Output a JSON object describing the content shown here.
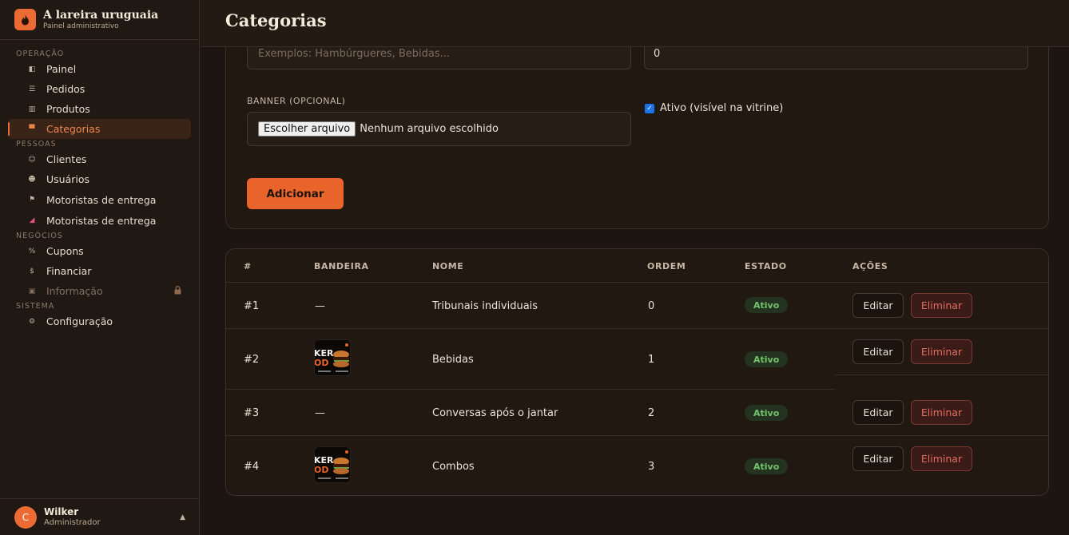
{
  "brand": {
    "title": "A lareira uruguaia",
    "subtitle": "Painel administrativo"
  },
  "sidebar": {
    "sections": [
      {
        "label": "OPERAÇÃO",
        "items": [
          {
            "label": "Painel",
            "icon": "layout-icon"
          },
          {
            "label": "Pedidos",
            "icon": "list-icon"
          },
          {
            "label": "Produtos",
            "icon": "grid-icon"
          },
          {
            "label": "Categorias",
            "icon": "folder-icon",
            "active": true
          }
        ]
      },
      {
        "label": "PESSOAS",
        "items": [
          {
            "label": "Clientes",
            "icon": "smile-icon"
          },
          {
            "label": "Usuários",
            "icon": "user-icon"
          },
          {
            "label": "Motoristas de entrega",
            "icon": "flag-icon"
          },
          {
            "label": "Motoristas de entrega",
            "icon": "scooter-icon"
          }
        ]
      },
      {
        "label": "NEGÓCIOS",
        "items": [
          {
            "label": "Cupons",
            "icon": "percent-icon"
          },
          {
            "label": "Financiar",
            "icon": "dollar-icon"
          },
          {
            "label": "Informação",
            "icon": "report-icon",
            "disabled": true,
            "locked": true
          }
        ]
      },
      {
        "label": "SISTEMA",
        "items": [
          {
            "label": "Configuração",
            "icon": "gear-icon"
          }
        ]
      }
    ]
  },
  "user": {
    "initial": "C",
    "name": "Wilker",
    "role": "Administrador"
  },
  "header": {
    "title": "Categorias"
  },
  "form": {
    "name_placeholder": "Exemplos: Hambúrgueres, Bebidas...",
    "order_value": "0",
    "banner_label": "BANNER (OPCIONAL)",
    "file_button": "Escolher arquivo",
    "file_status": "Nenhum arquivo escolhido",
    "active_label": "Ativo (visível na vitrine)",
    "active_checked": true,
    "submit_label": "Adicionar"
  },
  "table": {
    "headers": [
      "#",
      "BANDEIRA",
      "NOME",
      "ORDEM",
      "ESTADO",
      "AÇÕES"
    ],
    "edit_label": "Editar",
    "delete_label": "Eliminar",
    "rows": [
      {
        "id": "#1",
        "banner": "—",
        "name": "Tribunais individuais",
        "order": "0",
        "status": "Ativo"
      },
      {
        "id": "#2",
        "banner": "",
        "name": "Bebidas",
        "order": "1",
        "status": "Ativo"
      },
      {
        "id": "#3",
        "banner": "—",
        "name": "Conversas após o jantar",
        "order": "2",
        "status": "Ativo"
      },
      {
        "id": "#4",
        "banner": "",
        "name": "Combos",
        "order": "3",
        "status": "Ativo"
      }
    ]
  },
  "colors": {
    "accent": "#ec6a33",
    "background": "#1c1511",
    "success": "#74c26b",
    "danger": "#e46f61"
  }
}
